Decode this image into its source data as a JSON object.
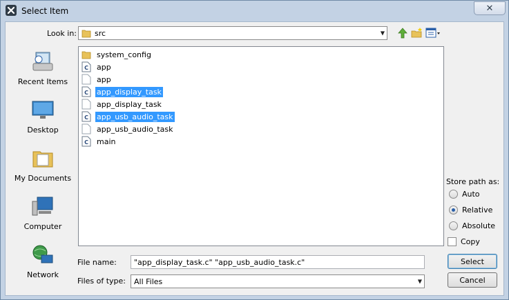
{
  "window": {
    "title": "Select Item",
    "close_glyph": "✕"
  },
  "toolbar": {
    "look_in_label": "Look in:",
    "look_in_value": "src",
    "icons": [
      "up-one-level-icon",
      "create-new-folder-icon",
      "view-menu-icon"
    ]
  },
  "places": [
    {
      "label": "Recent Items",
      "icon": "recent-items-icon"
    },
    {
      "label": "Desktop",
      "icon": "desktop-icon"
    },
    {
      "label": "My Documents",
      "icon": "my-documents-icon"
    },
    {
      "label": "Computer",
      "icon": "computer-icon"
    },
    {
      "label": "Network",
      "icon": "network-icon"
    }
  ],
  "files": [
    {
      "name": "system_config",
      "icon": "folder-icon",
      "selected": false
    },
    {
      "name": "app",
      "icon": "c-source-file-icon",
      "selected": false
    },
    {
      "name": "app",
      "icon": "text-file-icon",
      "selected": false
    },
    {
      "name": "app_display_task",
      "icon": "c-source-file-icon",
      "selected": true
    },
    {
      "name": "app_display_task",
      "icon": "text-file-icon",
      "selected": false
    },
    {
      "name": "app_usb_audio_task",
      "icon": "c-source-file-icon",
      "selected": true
    },
    {
      "name": "app_usb_audio_task",
      "icon": "text-file-icon",
      "selected": false
    },
    {
      "name": "main",
      "icon": "c-source-file-icon",
      "selected": false
    }
  ],
  "store_path": {
    "title": "Store path as:",
    "options": [
      "Auto",
      "Relative",
      "Absolute"
    ],
    "selected": "Relative",
    "copy_label": "Copy",
    "copy_checked": false
  },
  "footer": {
    "file_name_label": "File name:",
    "file_name_value": "\"app_display_task.c\" \"app_usb_audio_task.c\"",
    "files_of_type_label": "Files of type:",
    "files_of_type_value": "All Files",
    "select_label": "Select",
    "cancel_label": "Cancel"
  },
  "colors": {
    "selection": "#3399ff",
    "frame": "#c3d2e4"
  }
}
